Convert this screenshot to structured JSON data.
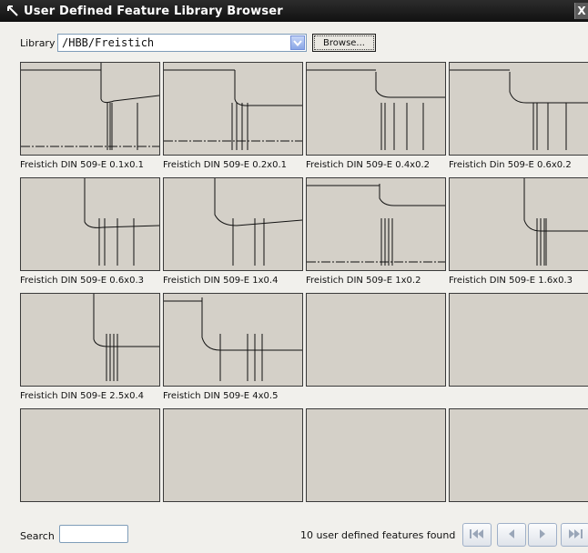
{
  "window": {
    "title": "User Defined Feature Library Browser",
    "close_label": "X"
  },
  "library": {
    "label": "Library",
    "value": "/HBB/Freistich",
    "browse_label": "Browse..."
  },
  "features": [
    {
      "name": "Freistich DIN 509-E 0.1x0.1"
    },
    {
      "name": "Freistich DIN 509-E 0.2x0.1"
    },
    {
      "name": "Freistich DIN 509-E 0.4x0.2"
    },
    {
      "name": "Freistich Din 509-E 0.6x0.2"
    },
    {
      "name": "Freistich DIN 509-E 0.6x0.3"
    },
    {
      "name": "Freistich DIN 509-E 1x0.4"
    },
    {
      "name": "Freistich DIN 509-E 1x0.2"
    },
    {
      "name": "Freistich DIN 509-E 1.6x0.3"
    },
    {
      "name": "Freistich DIN 509-E 2.5x0.4"
    },
    {
      "name": "Freistich DIN 509-E 4x0.5"
    },
    {
      "name": ""
    },
    {
      "name": ""
    },
    {
      "name": ""
    },
    {
      "name": ""
    },
    {
      "name": ""
    },
    {
      "name": ""
    }
  ],
  "search": {
    "label": "Search",
    "value": ""
  },
  "status": {
    "text": "10 user defined features found"
  },
  "pager": {
    "buttons": [
      "first-page-icon",
      "previous-page-icon",
      "next-page-icon",
      "last-page-icon"
    ]
  },
  "colors": {
    "thumbnail_bg": "#d4d0c8",
    "titlebar_bg": "#111111",
    "window_bg": "#f1f0ec"
  }
}
